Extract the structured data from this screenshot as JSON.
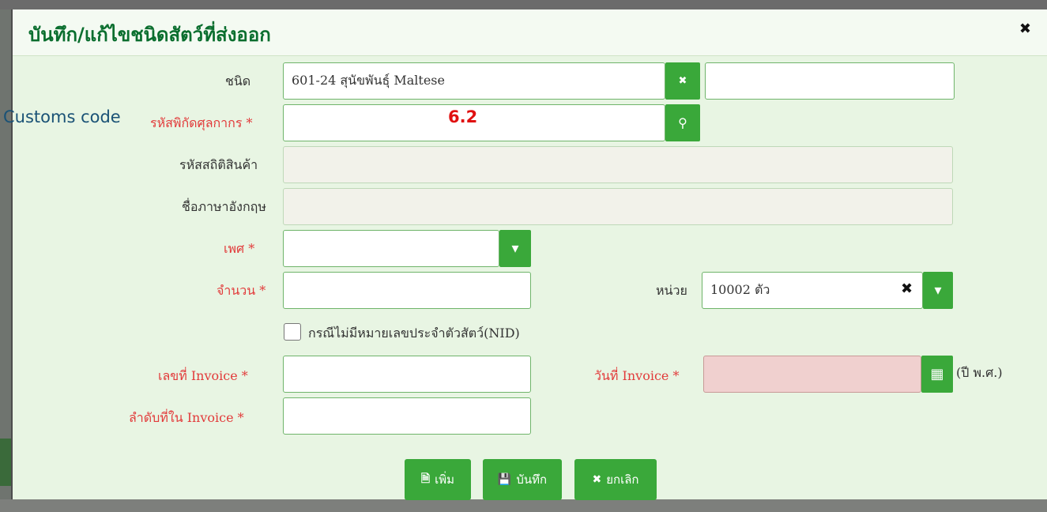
{
  "dialog": {
    "title": "บันทึก/แก้ไขชนิดสัตว์ที่ส่งออก",
    "close_glyph": "✖"
  },
  "annotation": {
    "english_label": "Customs code",
    "step_number": "6.2"
  },
  "form": {
    "type_label": "ชนิด",
    "type_value": "601-24 สุนัขพันธุ์ Maltese",
    "type_extra_value": "",
    "customs_code_label": "รหัสพิกัดศุลกากร *",
    "customs_code_value": "",
    "stat_code_label": "รหัสสถิติสินค้า",
    "stat_code_value": "",
    "english_name_label": "ชื่อภาษาอังกฤษ",
    "english_name_value": "",
    "sex_label": "เพศ *",
    "sex_value": "",
    "quantity_label": "จำนวน *",
    "quantity_value": "",
    "unit_label": "หน่วย",
    "unit_value": "10002 ตัว",
    "no_nid_label": "กรณีไม่มีหมายเลขประจำตัวสัตว์(NID)",
    "invoice_no_label": "เลขที่ Invoice *",
    "invoice_no_value": "",
    "invoice_date_label": "วันที่ Invoice *",
    "invoice_date_value": "",
    "invoice_date_suffix": "(ปี พ.ศ.)",
    "invoice_seq_label": "ลำดับที่ใน Invoice *",
    "invoice_seq_value": ""
  },
  "icons": {
    "clear": "✖",
    "search": "⚲",
    "dropdown": "▾",
    "calendar": "▦",
    "add_doc": "🗎",
    "save_disk": "💾",
    "cancel_x": "✖"
  },
  "actions": {
    "add_label": "เพิ่ม",
    "save_label": "บันทึก",
    "cancel_label": "ยกเลิก"
  },
  "colors": {
    "primary_green": "#3aa83a",
    "title_green": "#0a6e2e",
    "required_red": "#e23b3b",
    "invoice_date_bg": "#f0d0cf"
  }
}
